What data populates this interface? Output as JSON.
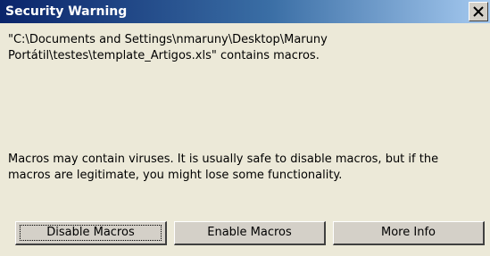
{
  "dialog": {
    "title": "Security Warning",
    "close_button": "×",
    "path_message_line1": "\"C:\\Documents and Settings\\nmaruny\\Desktop\\Maruny",
    "path_message_line2": "Portátil\\testes\\template_Artigos.xls\" contains macros.",
    "warning_line1": "Macros may contain viruses. It is usually safe to disable macros, but if the",
    "warning_line2": "macros are legitimate, you might lose some functionality."
  },
  "buttons": [
    {
      "label": "Disable Macros"
    },
    {
      "label": "Enable Macros"
    },
    {
      "label": "More Info"
    }
  ],
  "colors": {
    "title_bar_start": "#0a246a",
    "title_bar_end": "#a6caf0",
    "dialog_background": "#ece9d8"
  }
}
